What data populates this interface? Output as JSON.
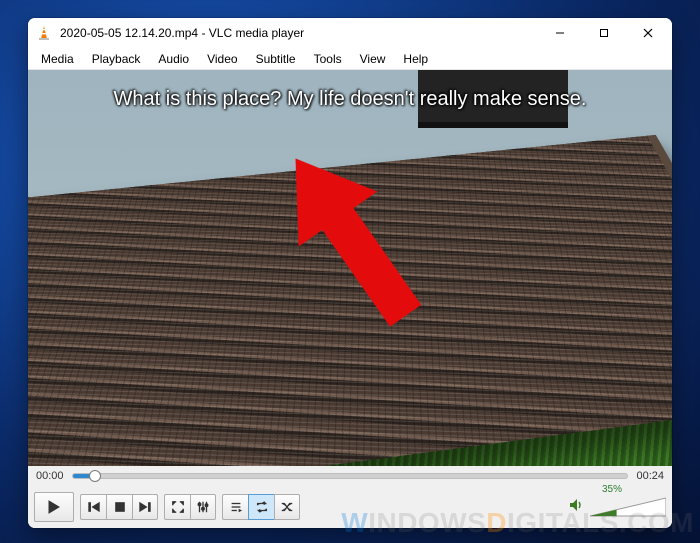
{
  "window": {
    "title": "2020-05-05 12.14.20.mp4 - VLC media player"
  },
  "menu": {
    "items": [
      "Media",
      "Playback",
      "Audio",
      "Video",
      "Subtitle",
      "Tools",
      "View",
      "Help"
    ]
  },
  "subtitle": {
    "text": "What is this place? My life doesn't really make sense."
  },
  "seek": {
    "current": "00:00",
    "duration": "00:24",
    "progress_pct": 4
  },
  "volume": {
    "label": "35%",
    "level_pct": 35
  },
  "icons": {
    "app": "vlc-cone",
    "minimize": "minimize",
    "maximize": "maximize",
    "close": "close",
    "play": "play",
    "prev": "prev",
    "stop": "stop",
    "next": "next",
    "fullscreen": "fullscreen",
    "ext": "equalizer",
    "playlist": "playlist",
    "loop": "loop",
    "shuffle": "shuffle",
    "speaker": "speaker"
  },
  "watermark": {
    "w": "W",
    "rest1": "indows",
    "d": "D",
    "rest2": "igitals.com"
  }
}
